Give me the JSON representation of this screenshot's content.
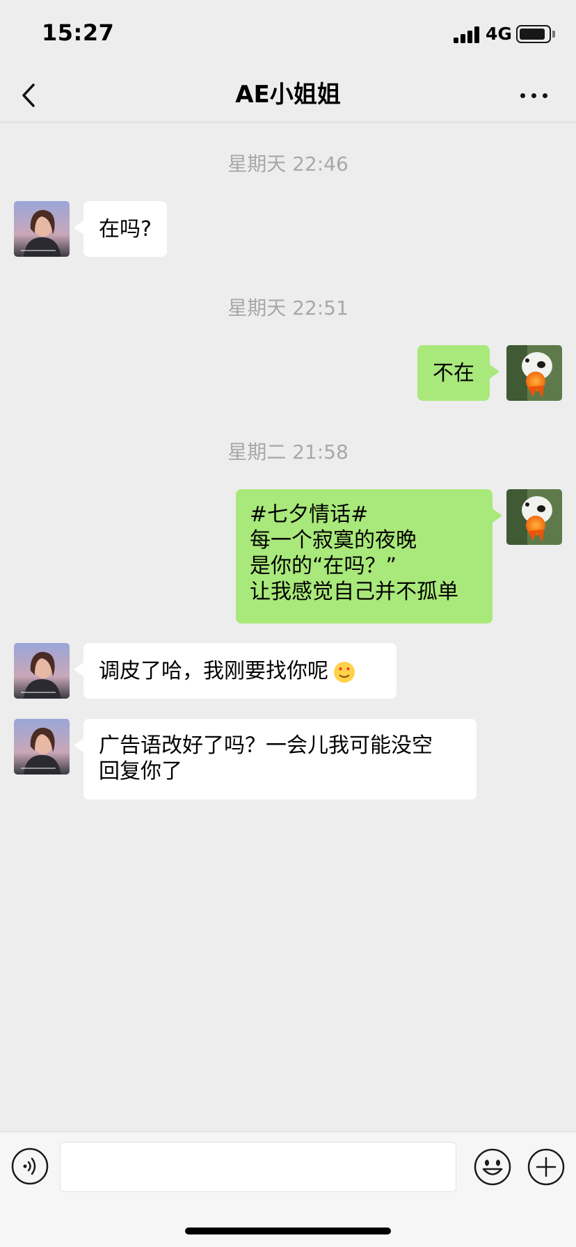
{
  "status_bar": {
    "time": "15:27",
    "network": "4G",
    "battery_level": 0.82
  },
  "nav": {
    "title": "AE小姐姐",
    "back_icon": "chevron-left-icon",
    "more_icon": "more-dots-icon"
  },
  "messages": [
    {
      "type": "timestamp",
      "text": "星期天 22:46"
    },
    {
      "type": "incoming",
      "text": "在吗?"
    },
    {
      "type": "timestamp",
      "text": "星期天 22:51"
    },
    {
      "type": "outgoing",
      "text": "不在"
    },
    {
      "type": "timestamp",
      "text": "星期二 21:58"
    },
    {
      "type": "outgoing",
      "text": "#七夕情话#\n每一个寂寞的夜晚\n是你的“在吗？”\n让我感觉自己并不孤单"
    },
    {
      "type": "incoming",
      "text": "调皮了哈，我刚要找你呢",
      "emoji": "heart-eyes-emoji"
    },
    {
      "type": "incoming",
      "text": "广告语改好了吗？一会儿我可能没空\n回复你了"
    }
  ],
  "input_bar": {
    "placeholder": "",
    "value": "",
    "voice_icon": "voice-icon",
    "emoji_icon": "emoji-icon",
    "plus_icon": "plus-icon"
  },
  "colors": {
    "background": "#ededed",
    "outgoing_bubble": "#a9e87a",
    "incoming_bubble": "#ffffff",
    "timestamp": "#a8a8a8"
  }
}
